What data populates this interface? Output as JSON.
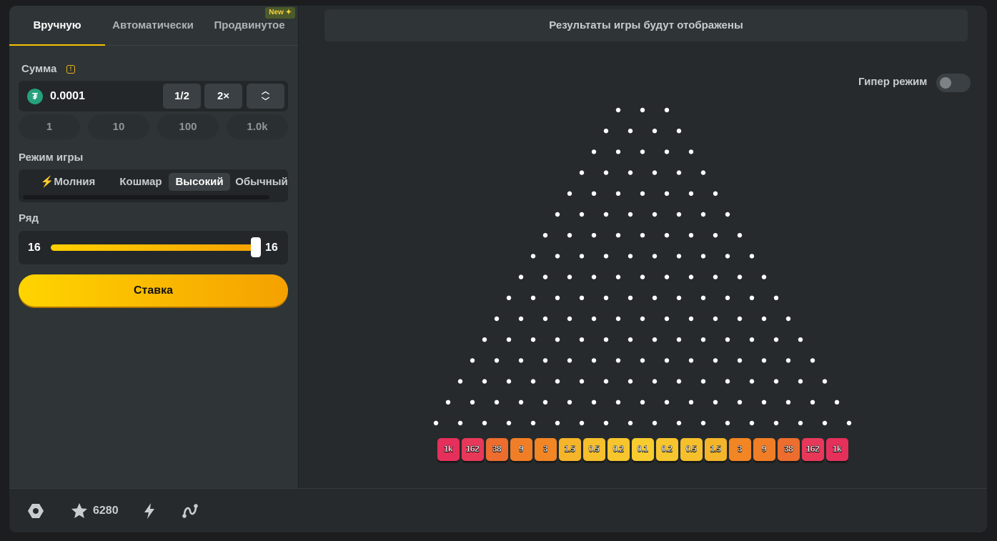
{
  "tabs": [
    {
      "label": "Вручную",
      "active": true
    },
    {
      "label": "Автоматически",
      "active": false
    },
    {
      "label": "Продвинутое",
      "active": false,
      "badge": "New"
    }
  ],
  "amount": {
    "label": "Сумма",
    "info_icon": "info-icon",
    "currency_icon": "usdt-icon",
    "value": "0.0001",
    "half_label": "1/2",
    "double_label": "2×",
    "quick_values": [
      "1",
      "10",
      "100",
      "1.0k"
    ]
  },
  "game_mode": {
    "label": "Режим игры",
    "options": [
      {
        "label": "Молния",
        "icon": "lightning-icon",
        "active": false
      },
      {
        "label": "Кошмар",
        "active": false
      },
      {
        "label": "Высокий",
        "active": true
      },
      {
        "label": "Обычный",
        "active": false
      }
    ]
  },
  "rows": {
    "label": "Ряд",
    "value": "16",
    "max_label": "16",
    "fill_fraction": 1.0
  },
  "bet_button_label": "Ставка",
  "results_text": "Результаты игры будут отображены",
  "hyper_mode": {
    "label": "Гипер режим",
    "on": false
  },
  "board": {
    "peg_rows": 16,
    "first_row_pegs": 3,
    "multipliers": [
      "1k",
      "162",
      "38",
      "9",
      "3",
      "1.5",
      "0.5",
      "0.2",
      "0.1",
      "0.2",
      "0.5",
      "1.5",
      "3",
      "9",
      "38",
      "162",
      "1k"
    ],
    "multiplier_colors": [
      "#e5305b",
      "#e8385a",
      "#ec6d2e",
      "#f07e26",
      "#f28524",
      "#f4b52a",
      "#f6bf2c",
      "#f7c62e",
      "#f8cc2f",
      "#f7c62e",
      "#f6bf2c",
      "#f4b52a",
      "#f28524",
      "#f07e26",
      "#ec6d2e",
      "#e8385a",
      "#e5305b"
    ]
  },
  "footer": {
    "icons": [
      "hexagon-icon",
      "star-icon",
      "lightning-icon",
      "route-icon"
    ],
    "star_count": "6280"
  }
}
